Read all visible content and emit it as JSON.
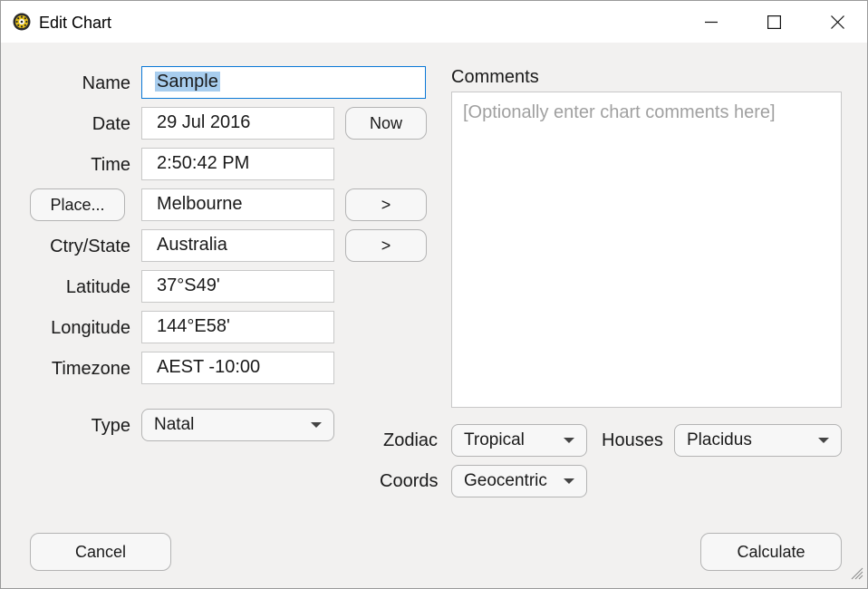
{
  "window": {
    "title": "Edit Chart",
    "icon": "sun-gear-icon"
  },
  "form": {
    "name_label": "Name",
    "name_value": "Sample",
    "date_label": "Date",
    "date_value": "29 Jul 2016",
    "now_button": "Now",
    "time_label": "Time",
    "time_value": "2:50:42 PM",
    "place_button": "Place...",
    "place_value": "Melbourne",
    "place_next": ">",
    "country_label": "Ctry/State",
    "country_value": "Australia",
    "country_next": ">",
    "latitude_label": "Latitude",
    "latitude_value": "37°S49'",
    "longitude_label": "Longitude",
    "longitude_value": "144°E58'",
    "timezone_label": "Timezone",
    "timezone_value": "AEST -10:00",
    "type_label": "Type",
    "type_value": "Natal"
  },
  "comments": {
    "label": "Comments",
    "placeholder": "[Optionally enter chart comments here]"
  },
  "settings": {
    "zodiac_label": "Zodiac",
    "zodiac_value": "Tropical",
    "houses_label": "Houses",
    "houses_value": "Placidus",
    "coords_label": "Coords",
    "coords_value": "Geocentric"
  },
  "footer": {
    "cancel": "Cancel",
    "calculate": "Calculate"
  },
  "colors": {
    "selection": "#a8cdee",
    "focus_border": "#0a78d7",
    "dialog_bg": "#f2f1f0"
  }
}
